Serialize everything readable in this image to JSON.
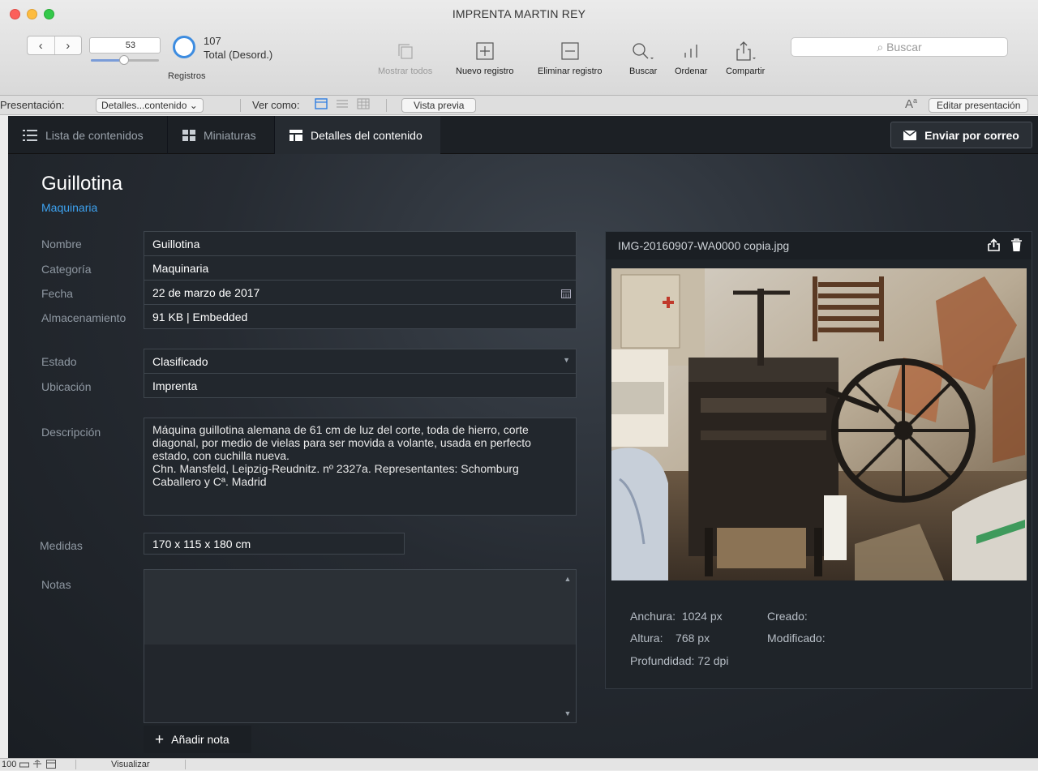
{
  "window": {
    "title": "IMPRENTA MARTIN REY"
  },
  "toolbar": {
    "record_number": "53",
    "record_position": 0.49,
    "total_count": "107",
    "total_label": "Total (Desord.)",
    "registros_label": "Registros",
    "show_all": "Mostrar todos",
    "new_record": "Nuevo registro",
    "delete_record": "Eliminar registro",
    "find": "Buscar",
    "sort": "Ordenar",
    "share": "Compartir",
    "search_placeholder": "Buscar"
  },
  "layoutbar": {
    "layout_label": "Presentación:",
    "layout_value": "Detalles...contenido",
    "view_as_label": "Ver como:",
    "preview": "Vista previa",
    "edit_layout": "Editar presentación"
  },
  "tabs": [
    {
      "label": "Lista de contenidos",
      "icon": "list-icon",
      "active": false
    },
    {
      "label": "Miniaturas",
      "icon": "grid-icon",
      "active": false
    },
    {
      "label": "Detalles del contenido",
      "icon": "details-icon",
      "active": true
    }
  ],
  "email_button": "Enviar por correo",
  "record": {
    "title": "Guillotina",
    "subtitle": "Maquinaria",
    "fields": {
      "nombre": {
        "label": "Nombre",
        "value": "Guillotina"
      },
      "categoria": {
        "label": "Categoría",
        "value": "Maquinaria"
      },
      "fecha": {
        "label": "Fecha",
        "value": "22 de marzo de 2017"
      },
      "almacenamiento": {
        "label": "Almacenamiento",
        "value": "91 KB | Embedded"
      },
      "estado": {
        "label": "Estado",
        "value": "Clasificado"
      },
      "ubicacion": {
        "label": "Ubicación",
        "value": "Imprenta"
      },
      "descripcion": {
        "label": "Descripción",
        "lines": [
          "Máquina guillotina alemana de 61 cm de luz del corte, toda de hierro, corte",
          "diagonal, por medio de vielas para ser movida a volante, usada en perfecto",
          "estado, con cuchilla nueva.",
          "Chn. Mansfeld, Leipzig-Reudnitz. nº 2327a. Representantes: Schomburg",
          "Caballero y Cª. Madrid"
        ]
      },
      "medidas": {
        "label": "Medidas",
        "value": "170 x 115 x 180 cm"
      },
      "notas": {
        "label": "Notas",
        "value": ""
      }
    },
    "add_note": "Añadir nota"
  },
  "image": {
    "filename": "IMG-20160907-WA0000 copia.jpg",
    "width_label": "Anchura:",
    "width_value": "1024 px",
    "height_label": "Altura:",
    "height_value": "768 px",
    "depth_label": "Profundidad:",
    "depth_value": "72 dpi",
    "created_label": "Creado:",
    "modified_label": "Modificado:"
  },
  "statusbar": {
    "zoom": "100",
    "mode": "Visualizar"
  },
  "colors": {
    "accent": "#3da2f0",
    "panel": "#22272d",
    "tab_active": "#262b31"
  }
}
